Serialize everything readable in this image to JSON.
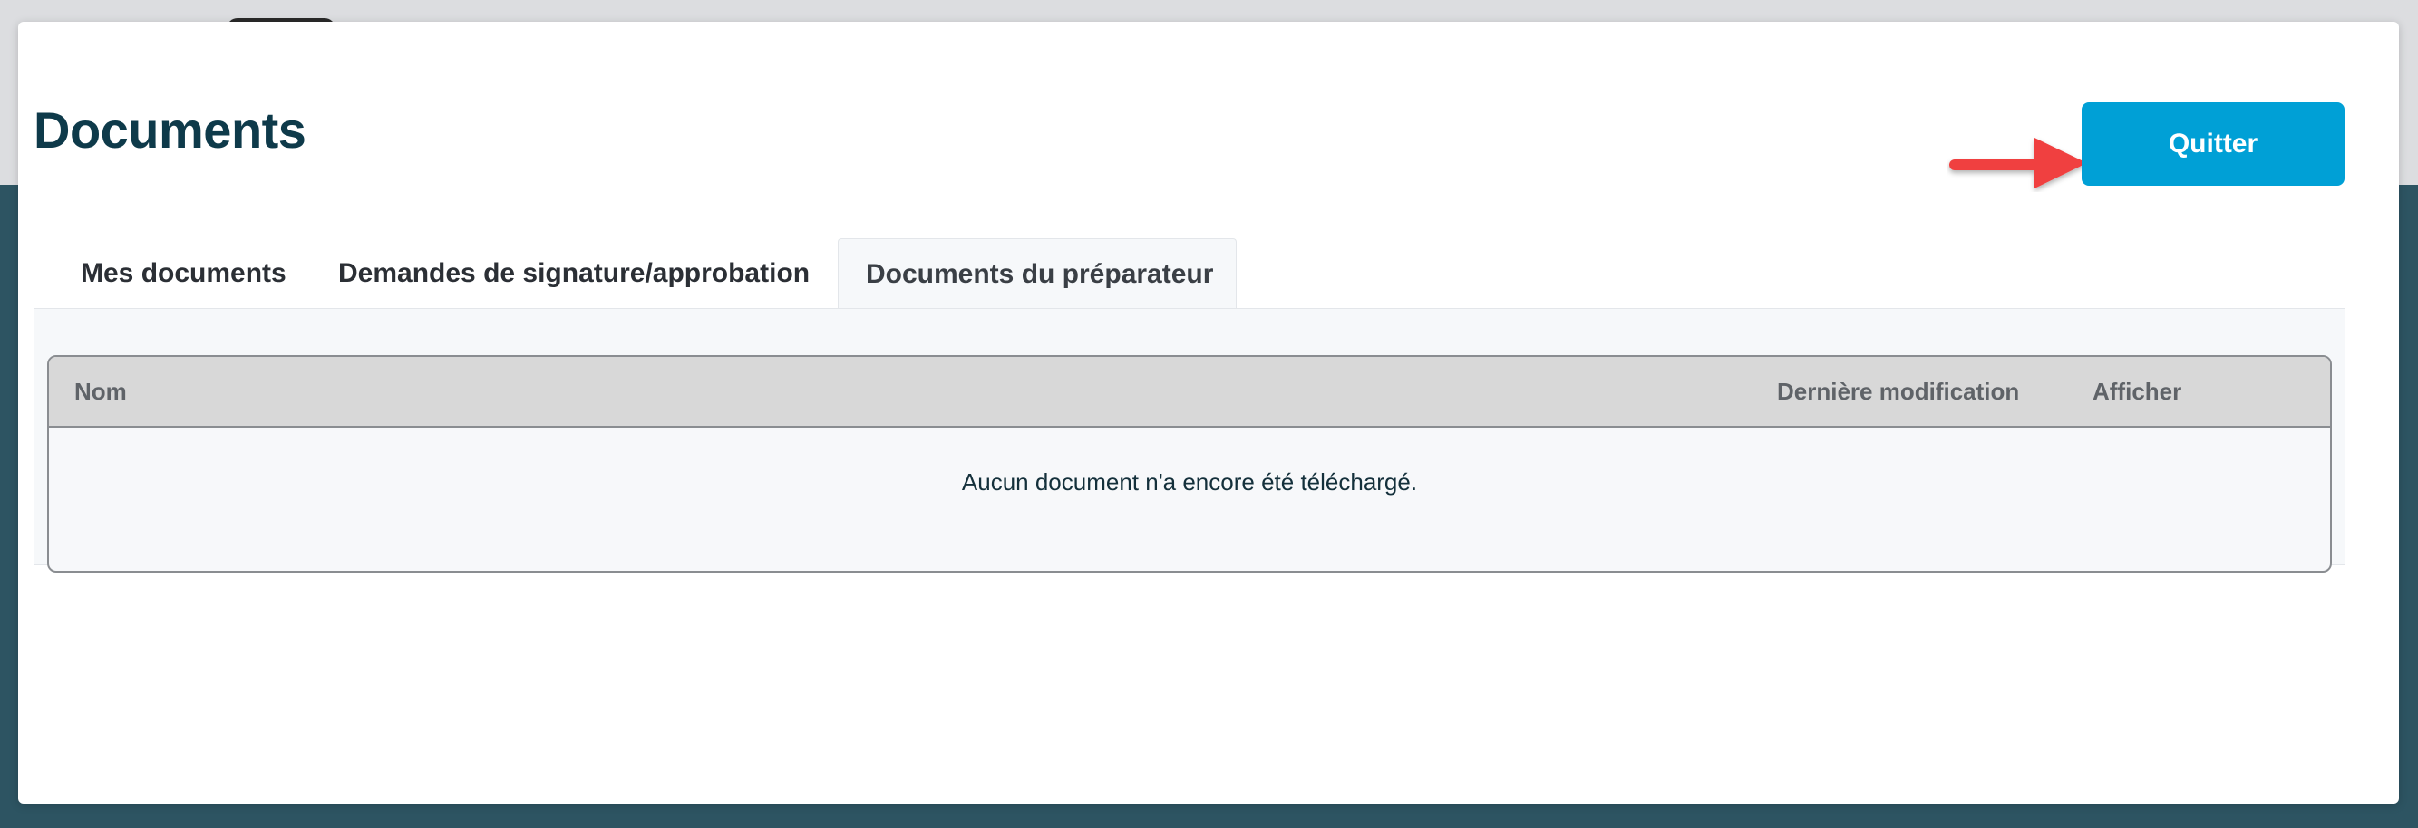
{
  "page": {
    "title": "Documents"
  },
  "header": {
    "quit_label": "Quitter"
  },
  "tabs": [
    {
      "label": "Mes documents",
      "active": false
    },
    {
      "label": "Demandes de signature/approbation",
      "active": false
    },
    {
      "label": "Documents du préparateur",
      "active": true
    }
  ],
  "table": {
    "columns": [
      "Nom",
      "Dernière modification",
      "Afficher"
    ],
    "empty_message": "Aucun document n'a encore été téléchargé."
  },
  "colors": {
    "accent": "#00a0d6",
    "title": "#0e3a4a",
    "backdrop": "#2d5462",
    "annotation_arrow": "#f04040"
  }
}
